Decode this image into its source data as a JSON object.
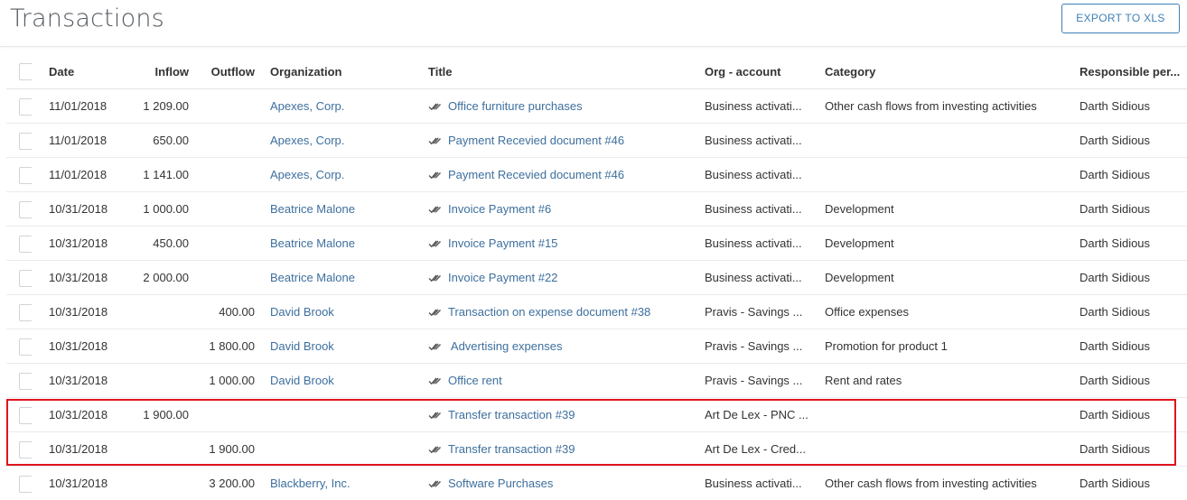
{
  "header": {
    "title": "Transactions",
    "export_label": "EXPORT TO XLS"
  },
  "columns": {
    "date": "Date",
    "inflow": "Inflow",
    "outflow": "Outflow",
    "organization": "Organization",
    "title": "Title",
    "org_account": "Org - account",
    "category": "Category",
    "responsible": "Responsible per..."
  },
  "rows": [
    {
      "date": "11/01/2018",
      "inflow": "1 209.00",
      "outflow": "",
      "organization": "Apexes, Corp.",
      "title": "Office furniture purchases",
      "org_account": "Business activati...",
      "category": "Other cash flows from investing activities",
      "responsible": "Darth Sidious"
    },
    {
      "date": "11/01/2018",
      "inflow": "650.00",
      "outflow": "",
      "organization": "Apexes, Corp.",
      "title": "Payment Recevied document #46",
      "org_account": "Business activati...",
      "category": "",
      "responsible": "Darth Sidious"
    },
    {
      "date": "11/01/2018",
      "inflow": "1 141.00",
      "outflow": "",
      "organization": "Apexes, Corp.",
      "title": "Payment Recevied document #46",
      "org_account": "Business activati...",
      "category": "",
      "responsible": "Darth Sidious"
    },
    {
      "date": "10/31/2018",
      "inflow": "1 000.00",
      "outflow": "",
      "organization": "Beatrice Malone",
      "title": "Invoice Payment #6",
      "org_account": "Business activati...",
      "category": "Development",
      "responsible": "Darth Sidious"
    },
    {
      "date": "10/31/2018",
      "inflow": "450.00",
      "outflow": "",
      "organization": "Beatrice Malone",
      "title": "Invoice Payment #15",
      "org_account": "Business activati...",
      "category": "Development",
      "responsible": "Darth Sidious"
    },
    {
      "date": "10/31/2018",
      "inflow": "2 000.00",
      "outflow": "",
      "organization": "Beatrice Malone",
      "title": "Invoice Payment #22",
      "org_account": "Business activati...",
      "category": "Development",
      "responsible": "Darth Sidious"
    },
    {
      "date": "10/31/2018",
      "inflow": "",
      "outflow": "400.00",
      "organization": "David Brook",
      "title": "Transaction on expense document #38",
      "org_account": "Pravis - Savings ...",
      "category": "Office expenses",
      "responsible": "Darth Sidious"
    },
    {
      "date": "10/31/2018",
      "inflow": "",
      "outflow": "1 800.00",
      "organization": "David Brook",
      "title": " Advertising expenses",
      "org_account": "Pravis - Savings ...",
      "category": "Promotion for product 1",
      "responsible": "Darth Sidious"
    },
    {
      "date": "10/31/2018",
      "inflow": "",
      "outflow": "1 000.00",
      "organization": "David Brook",
      "title": "Office rent",
      "org_account": "Pravis - Savings ...",
      "category": "Rent and rates",
      "responsible": "Darth Sidious"
    },
    {
      "date": "10/31/2018",
      "inflow": "1 900.00",
      "outflow": "",
      "organization": "",
      "title": "Transfer transaction #39",
      "org_account": "Art De Lex - PNC ...",
      "category": "",
      "responsible": "Darth Sidious"
    },
    {
      "date": "10/31/2018",
      "inflow": "",
      "outflow": "1 900.00",
      "organization": "",
      "title": "Transfer transaction #39",
      "org_account": "Art De Lex - Cred...",
      "category": "",
      "responsible": "Darth Sidious"
    },
    {
      "date": "10/31/2018",
      "inflow": "",
      "outflow": "3 200.00",
      "organization": "Blackberry, Inc.",
      "title": "Software Purchases",
      "org_account": "Business activati...",
      "category": "Other cash flows from investing activities",
      "responsible": "Darth Sidious"
    }
  ],
  "icons": {
    "title_status": "double-check-icon",
    "row_select": "checkbox"
  },
  "colors": {
    "link": "#3d6f9e",
    "button_accent": "#3d7fb8",
    "highlight": "#e0141e"
  }
}
